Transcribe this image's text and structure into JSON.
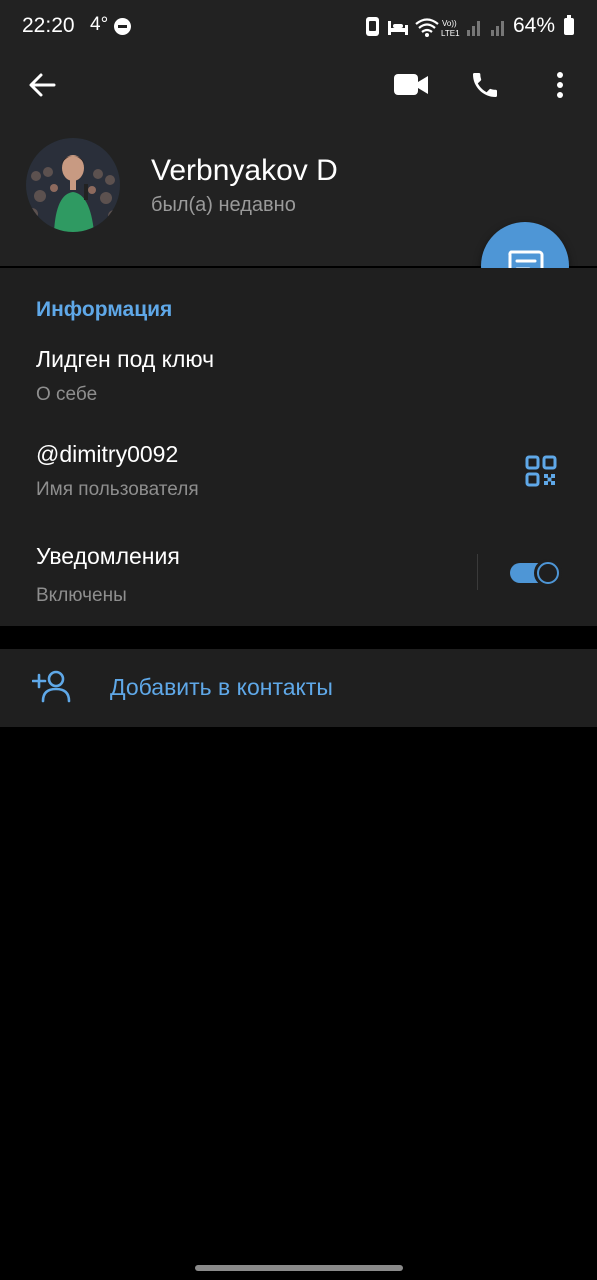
{
  "status_bar": {
    "time": "22:20",
    "temperature": "4°",
    "battery_percent": "64%",
    "icons": [
      "dnd-icon",
      "nfc-icon",
      "bed-icon",
      "wifi-icon",
      "volte-icon",
      "signal-icon",
      "signal-icon-2",
      "battery-icon"
    ]
  },
  "toolbar": {
    "back_icon": "arrow-left-icon",
    "video_call_icon": "video-camera-icon",
    "call_icon": "phone-icon",
    "more_icon": "more-vertical-icon"
  },
  "profile": {
    "name": "Verbnyakov D",
    "last_seen": "был(а) недавно",
    "fab_icon": "message-icon"
  },
  "info": {
    "section_title": "Информация",
    "bio_value": "Лидген под ключ",
    "bio_label": "О себе",
    "username_value": "@dimitry0092",
    "username_label": "Имя пользователя",
    "qr_icon": "qr-code-icon",
    "notifications_value": "Уведомления",
    "notifications_label": "Включены",
    "notifications_enabled": true
  },
  "actions": {
    "add_contact_label": "Добавить в контакты",
    "add_contact_icon": "add-user-icon"
  },
  "colors": {
    "accent": "#5fa8e8",
    "fab": "#4e96d6",
    "surface": "#1f1f1f",
    "header": "#222222",
    "background": "#000000"
  }
}
